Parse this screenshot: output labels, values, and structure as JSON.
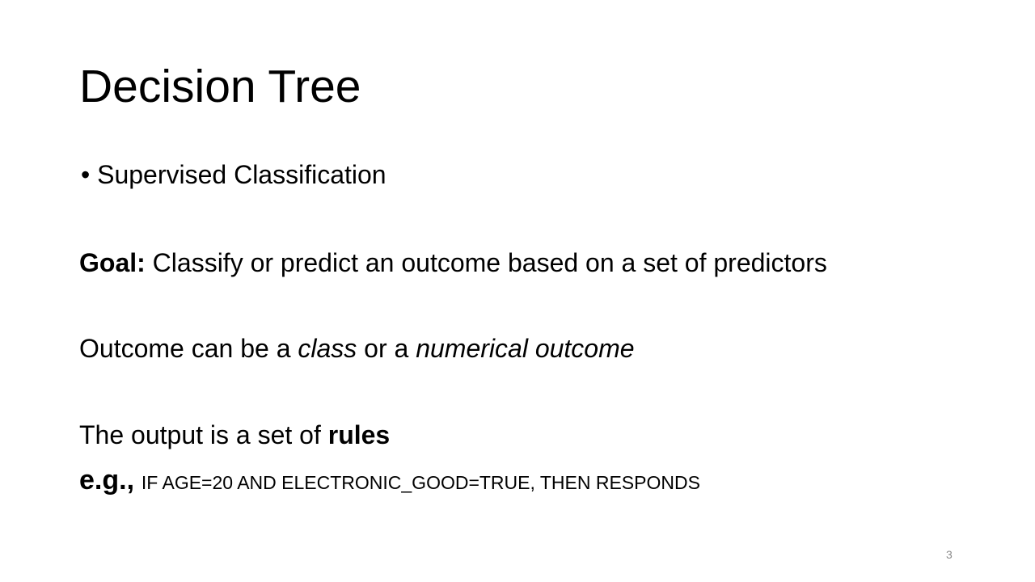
{
  "slide": {
    "title": "Decision Tree",
    "bullet": {
      "marker": "•",
      "text": "Supervised Classification"
    },
    "goal": {
      "label": "Goal:",
      "text": "Classify or predict an outcome based on a set of predictors"
    },
    "outcome": {
      "prefix": "Outcome can be a ",
      "emph_class": "class",
      "middle": " or a ",
      "emph_numerical": "numerical outcome"
    },
    "output": {
      "prefix": "The output is a set of ",
      "emph": "rules"
    },
    "example": {
      "label": "e.g.,",
      "rule": "IF AGE=20 AND ELECTRONIC_GOOD=TRUE, THEN RESPONDS"
    },
    "page_number": "3"
  }
}
